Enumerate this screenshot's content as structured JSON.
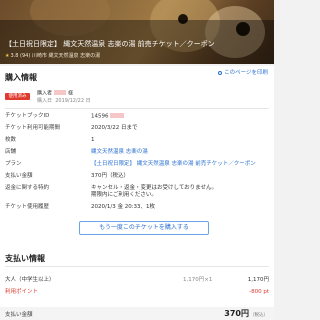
{
  "hero": {
    "title": "【土日祝日限定】 縄文天然温泉 志楽の湯 前売チケット／クーポン",
    "rating_star": "★",
    "rating": "3.8",
    "reviews": "(94)",
    "area": "川崎市 縄文天然温泉 志楽の湯"
  },
  "purchase": {
    "section_title": "購入情報",
    "print_link": "このページを印刷",
    "badge": "使用済み",
    "buyer_label": "購入者",
    "buyer_suffix": "様",
    "purchase_date_label": "購入日",
    "purchase_date": "2019/12/22 日",
    "rows": [
      {
        "label": "チケットブックID",
        "value": "14596"
      },
      {
        "label": "チケット利用可能期間",
        "value": "2020/3/22 日まで"
      },
      {
        "label": "枚数",
        "value": "1"
      },
      {
        "label": "店舗",
        "value": "縄文天然温泉 志楽の湯"
      },
      {
        "label": "プラン",
        "value": "【土日祝日限定】 縄文天然温泉 志楽の湯 前売チケット／クーポン"
      },
      {
        "label": "支払い金額",
        "value": "370円（税込）"
      },
      {
        "label": "返金に関する特約",
        "value": "キャンセル・返金・変更はお受けしておりません。\n期限内にご利用ください。"
      },
      {
        "label": "チケット使用履歴",
        "value": "2020/1/3 金 20:33、1枚"
      }
    ],
    "more_button": "もう一度このチケットを購入する"
  },
  "payment": {
    "section_title": "支払い情報",
    "adult_label": "大人（中学生以上）",
    "adult_unit": "1,170円×1",
    "adult_amount": "1,170円",
    "points_label": "利用ポイント",
    "points_amount": "-800 pt",
    "total_label": "支払い金額",
    "total_amount": "370円",
    "total_tax": "（税込）"
  },
  "colors": {
    "accent": "#2a6fd0",
    "danger": "#e03a2e"
  }
}
